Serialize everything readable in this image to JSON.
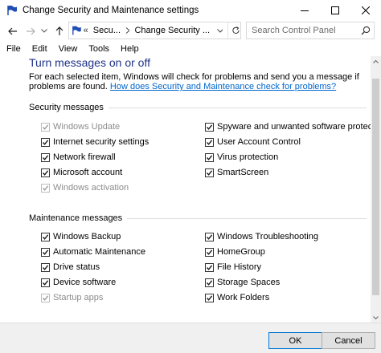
{
  "window": {
    "title": "Change Security and Maintenance settings"
  },
  "address": {
    "prefix": "«",
    "crumb1": "Secu...",
    "crumb2": "Change Security ...",
    "search_placeholder": "Search Control Panel"
  },
  "menu": [
    "File",
    "Edit",
    "View",
    "Tools",
    "Help"
  ],
  "content": {
    "heading": "Turn messages on or off",
    "description": "For each selected item, Windows will check for problems and send you a message if problems are found.",
    "link": "How does Security and Maintenance check for problems?"
  },
  "security": {
    "title": "Security messages",
    "left": [
      {
        "label": "Windows Update",
        "checked": true,
        "disabled": true
      },
      {
        "label": "Internet security settings",
        "checked": true,
        "disabled": false
      },
      {
        "label": "Network firewall",
        "checked": true,
        "disabled": false
      },
      {
        "label": "Microsoft account",
        "checked": true,
        "disabled": false
      },
      {
        "label": "Windows activation",
        "checked": true,
        "disabled": true
      }
    ],
    "right": [
      {
        "label": "Spyware and unwanted software protection",
        "checked": true,
        "disabled": false
      },
      {
        "label": "User Account Control",
        "checked": true,
        "disabled": false
      },
      {
        "label": "Virus protection",
        "checked": true,
        "disabled": false
      },
      {
        "label": "SmartScreen",
        "checked": true,
        "disabled": false
      }
    ]
  },
  "maintenance": {
    "title": "Maintenance messages",
    "left": [
      {
        "label": "Windows Backup",
        "checked": true,
        "disabled": false
      },
      {
        "label": "Automatic Maintenance",
        "checked": true,
        "disabled": false
      },
      {
        "label": "Drive status",
        "checked": true,
        "disabled": false
      },
      {
        "label": "Device software",
        "checked": true,
        "disabled": false
      },
      {
        "label": "Startup apps",
        "checked": true,
        "disabled": true
      }
    ],
    "right": [
      {
        "label": "Windows Troubleshooting",
        "checked": true,
        "disabled": false
      },
      {
        "label": "HomeGroup",
        "checked": true,
        "disabled": false
      },
      {
        "label": "File History",
        "checked": true,
        "disabled": false
      },
      {
        "label": "Storage Spaces",
        "checked": true,
        "disabled": false
      },
      {
        "label": "Work Folders",
        "checked": true,
        "disabled": false
      }
    ]
  },
  "buttons": {
    "ok": "OK",
    "cancel": "Cancel"
  },
  "colors": {
    "heading": "#1e3287",
    "link": "#0066cc",
    "flag": "#1f4fb4"
  }
}
